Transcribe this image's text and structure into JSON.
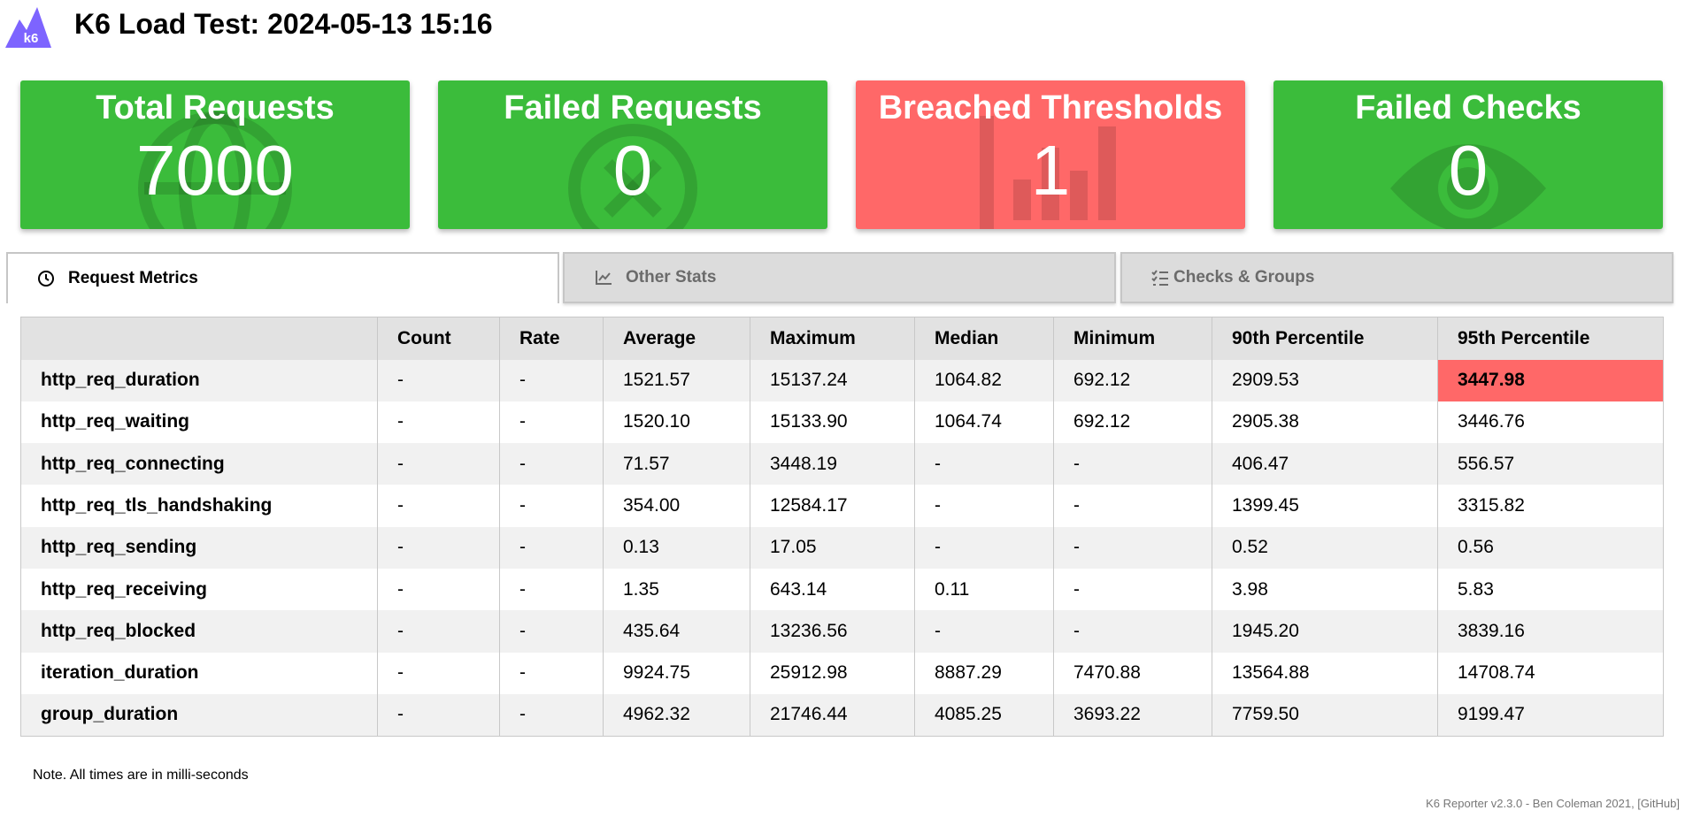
{
  "header": {
    "logo_text": "k6",
    "title": "K6 Load Test: 2024-05-13 15:16"
  },
  "cards": [
    {
      "title": "Total Requests",
      "value": "7000",
      "status": "good",
      "icon": "globe-icon"
    },
    {
      "title": "Failed Requests",
      "value": "0",
      "status": "good",
      "icon": "x-circle-icon"
    },
    {
      "title": "Breached Thresholds",
      "value": "1",
      "status": "bad",
      "icon": "chart-icon"
    },
    {
      "title": "Failed Checks",
      "value": "0",
      "status": "good",
      "icon": "eye-icon"
    }
  ],
  "colors": {
    "good": "#3bbc3b",
    "bad": "#ff6868"
  },
  "tabs": [
    {
      "label": "Request Metrics",
      "icon": "clock-icon",
      "active": true
    },
    {
      "label": "Other Stats",
      "icon": "line-chart-icon",
      "active": false
    },
    {
      "label": "Checks & Groups",
      "icon": "checklist-icon",
      "active": false
    }
  ],
  "table": {
    "columns": [
      "",
      "Count",
      "Rate",
      "Average",
      "Maximum",
      "Median",
      "Minimum",
      "90th Percentile",
      "95th Percentile"
    ],
    "rows": [
      [
        "http_req_duration",
        "-",
        "-",
        "1521.57",
        "15137.24",
        "1064.82",
        "692.12",
        "2909.53",
        "3447.98"
      ],
      [
        "http_req_waiting",
        "-",
        "-",
        "1520.10",
        "15133.90",
        "1064.74",
        "692.12",
        "2905.38",
        "3446.76"
      ],
      [
        "http_req_connecting",
        "-",
        "-",
        "71.57",
        "3448.19",
        "-",
        "-",
        "406.47",
        "556.57"
      ],
      [
        "http_req_tls_handshaking",
        "-",
        "-",
        "354.00",
        "12584.17",
        "-",
        "-",
        "1399.45",
        "3315.82"
      ],
      [
        "http_req_sending",
        "-",
        "-",
        "0.13",
        "17.05",
        "-",
        "-",
        "0.52",
        "0.56"
      ],
      [
        "http_req_receiving",
        "-",
        "-",
        "1.35",
        "643.14",
        "0.11",
        "-",
        "3.98",
        "5.83"
      ],
      [
        "http_req_blocked",
        "-",
        "-",
        "435.64",
        "13236.56",
        "-",
        "-",
        "1945.20",
        "3839.16"
      ],
      [
        "iteration_duration",
        "-",
        "-",
        "9924.75",
        "25912.98",
        "8887.29",
        "7470.88",
        "13564.88",
        "14708.74"
      ],
      [
        "group_duration",
        "-",
        "-",
        "4962.32",
        "21746.44",
        "4085.25",
        "3693.22",
        "7759.50",
        "9199.47"
      ]
    ]
  },
  "note": "Note. All times are in milli-seconds",
  "footer": "K6 Reporter v2.3.0 - Ben Coleman 2021, [GitHub]"
}
